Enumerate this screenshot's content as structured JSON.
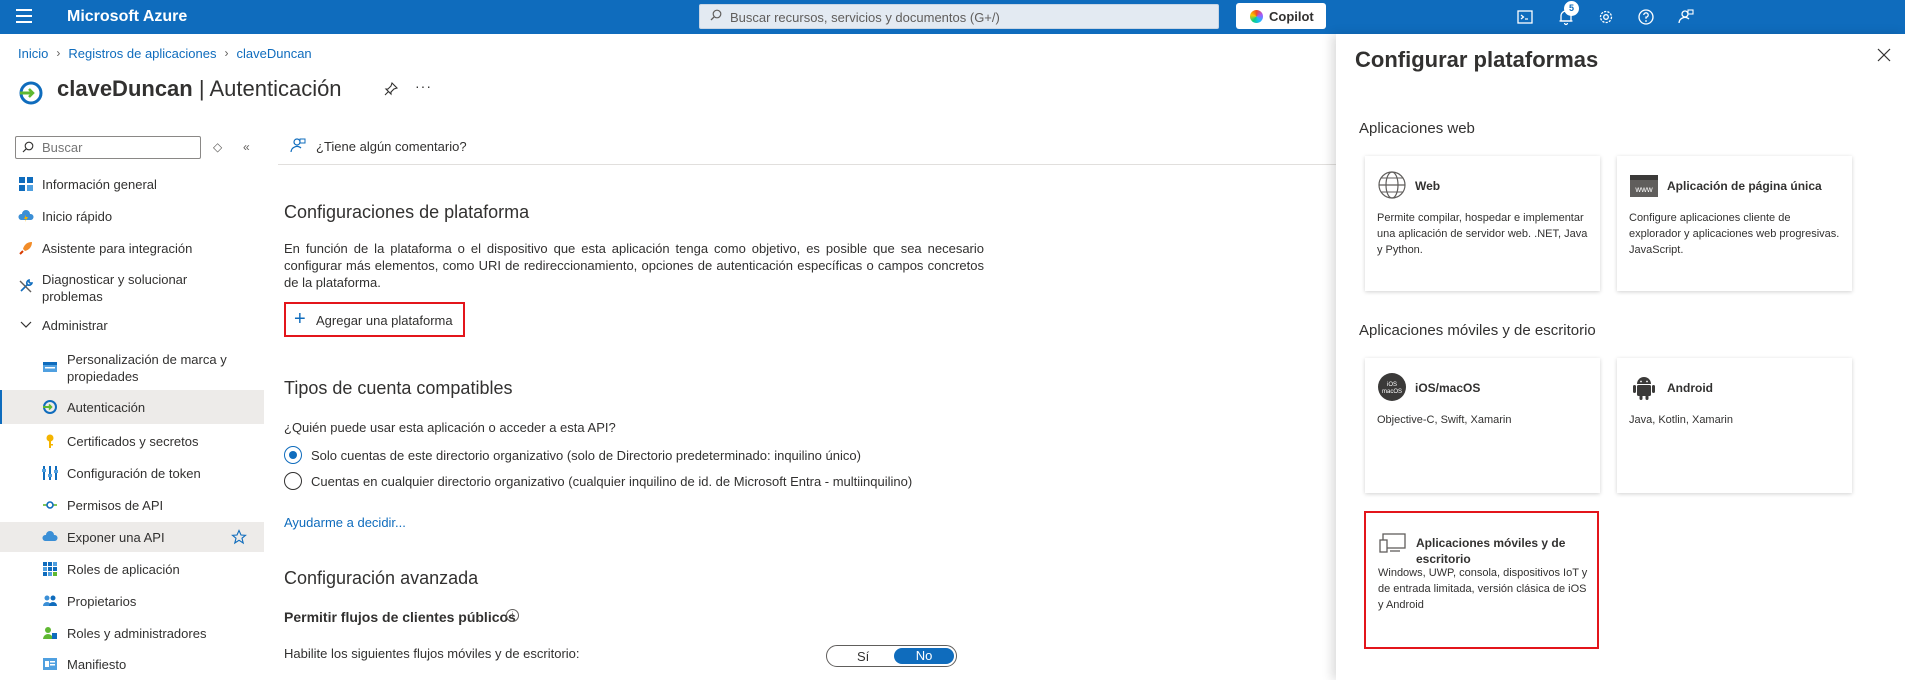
{
  "topbar": {
    "brand": "Microsoft Azure",
    "search_placeholder": "Buscar recursos, servicios y documentos (G+/)",
    "copilot_label": "Copilot",
    "notifications_count": "5"
  },
  "breadcrumb": {
    "items": [
      "Inicio",
      "Registros de aplicaciones",
      "claveDuncan"
    ]
  },
  "page": {
    "app_name": "claveDuncan",
    "section": " | Autenticación",
    "more": "···"
  },
  "sidebar": {
    "search_placeholder": "Buscar",
    "items": [
      {
        "label": "Información general"
      },
      {
        "label": "Inicio rápido"
      },
      {
        "label": "Asistente para integración"
      },
      {
        "label": "Diagnosticar y solucionar problemas"
      },
      {
        "label": "Administrar"
      },
      {
        "label": "Personalización de marca y propiedades"
      },
      {
        "label": "Autenticación"
      },
      {
        "label": "Certificados y secretos"
      },
      {
        "label": "Configuración de token"
      },
      {
        "label": "Permisos de API"
      },
      {
        "label": "Exponer una API"
      },
      {
        "label": "Roles de aplicación"
      },
      {
        "label": "Propietarios"
      },
      {
        "label": "Roles y administradores"
      },
      {
        "label": "Manifiesto"
      }
    ]
  },
  "main": {
    "feedback": "¿Tiene algún comentario?",
    "platform_config": {
      "heading": "Configuraciones de plataforma",
      "description": "En función de la plataforma o el dispositivo que esta aplicación tenga como objetivo, es posible que sea necesario configurar más elementos, como URI de redireccionamiento, opciones de autenticación específicas o campos concretos de la plataforma.",
      "add_button": "Agregar una plataforma"
    },
    "account_types": {
      "heading": "Tipos de cuenta compatibles",
      "question": "¿Quién puede usar esta aplicación o acceder a esta API?",
      "options": [
        "Solo cuentas de este directorio organizativo (solo de Directorio predeterminado: inquilino único)",
        "Cuentas en cualquier directorio organizativo (cualquier inquilino de id. de Microsoft Entra - multiinquilino)"
      ],
      "selected_index": 0,
      "help_link": "Ayudarme a decidir..."
    },
    "advanced": {
      "heading": "Configuración avanzada",
      "public_flows": "Permitir flujos de clientes públicos",
      "enable_text": "Habilite los siguientes flujos móviles y de escritorio:",
      "toggle_yes": "Sí",
      "toggle_no": "No",
      "toggle_value": "No"
    }
  },
  "panel": {
    "title": "Configurar plataformas",
    "web_section": "Aplicaciones web",
    "mobile_section": "Aplicaciones móviles y de escritorio",
    "cards": {
      "web": {
        "title": "Web",
        "description": "Permite compilar, hospedar e implementar una aplicación de servidor web. .NET, Java y Python."
      },
      "spa": {
        "title": "Aplicación de página única",
        "description": "Configure aplicaciones cliente de explorador y aplicaciones web progresivas. JavaScript.",
        "icon_text": "www"
      },
      "ios": {
        "title": "iOS/macOS",
        "description": "Objective-C, Swift, Xamarin",
        "icon_text": "iOS macOS"
      },
      "android": {
        "title": "Android",
        "description": "Java, Kotlin, Xamarin"
      },
      "desktop": {
        "title": "Aplicaciones móviles y de escritorio",
        "description": "Windows, UWP, consola, dispositivos IoT y de entrada limitada, versión clásica de iOS y Android"
      }
    }
  },
  "colors": {
    "accent": "#0f6cbd",
    "highlight": "#e3151b"
  }
}
